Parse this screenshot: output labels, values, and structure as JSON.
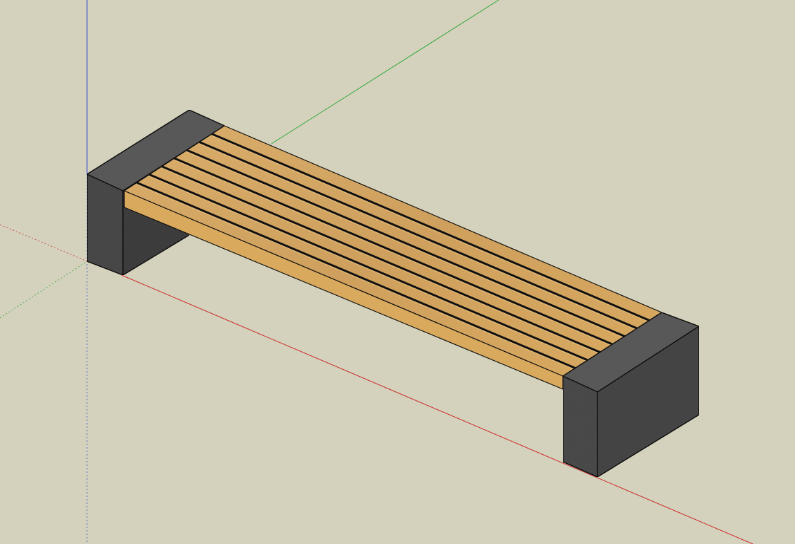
{
  "scene": {
    "description_visible_text": "",
    "colors": {
      "background": "#d4d2bc",
      "axis_red": "#cc2a2a",
      "axis_green": "#2fa83a",
      "axis_blue": "#3a4fd6",
      "granite_top": "#5a5a5a",
      "granite_front": "#4a4a4a",
      "granite_side": "#404040",
      "wood_top": "#d7a761",
      "wood_edge": "#c48f47",
      "outline": "#111111"
    },
    "icons": {
      "origin": "axis-origin-icon"
    },
    "object": {
      "type": "bench",
      "slat_count": 8,
      "support_count": 2,
      "support_material": "granite",
      "seat_material": "wood"
    }
  }
}
